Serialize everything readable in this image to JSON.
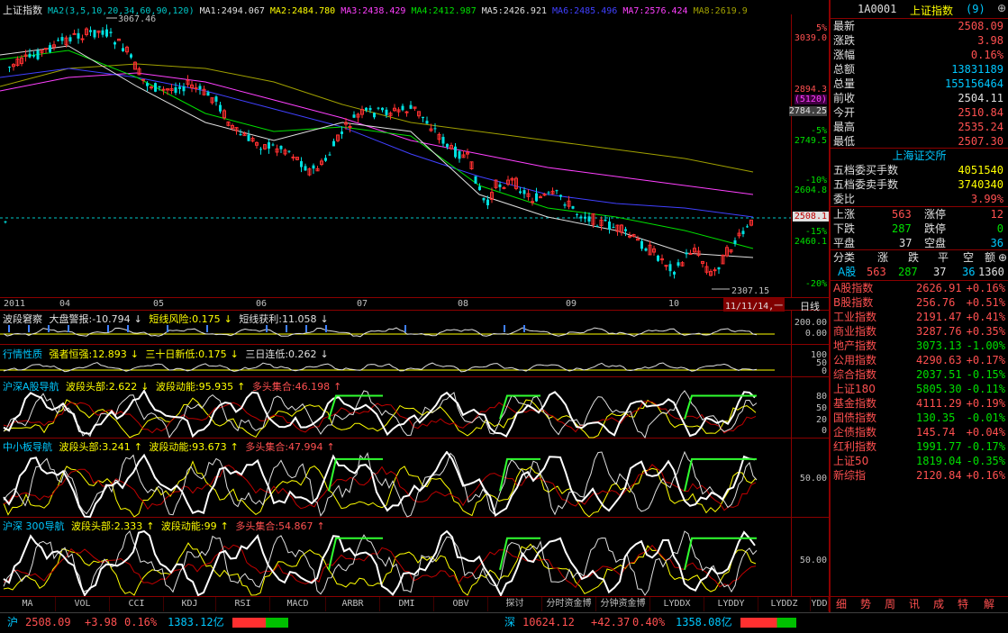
{
  "main_header": {
    "title": "上证指数",
    "ma2": "MA2(3,5,10,20,34,60,90,120)",
    "ma1": "MA1:2494.067",
    "ma2v": "MA2:2484.780",
    "ma3": "MA3:2438.429",
    "ma4": "MA4:2412.987",
    "ma5": "MA5:2426.921",
    "ma6": "MA6:2485.496",
    "ma7": "MA7:2576.424",
    "ma8": "MA8:2619.9"
  },
  "price_axis": {
    "high_mark": "3067.46",
    "low_mark": "2307.15",
    "labels": [
      {
        "pct": "5%",
        "val": "3039.0"
      },
      {
        "pct": "",
        "val": "2894.3"
      },
      {
        "pct": "",
        "val": "(5120)"
      },
      {
        "pct": "",
        "val": "2784.25"
      },
      {
        "pct": "-5%",
        "val": "2749.5"
      },
      {
        "pct": "-10%",
        "val": "2604.8"
      },
      {
        "pct": "",
        "val": "2508.1"
      },
      {
        "pct": "-15%",
        "val": "2460.1"
      },
      {
        "pct": "-20%",
        "val": ""
      }
    ]
  },
  "time_axis": {
    "labels": [
      "2011",
      "04",
      "05",
      "06",
      "07",
      "08",
      "09",
      "10"
    ],
    "cursor_date": "11/11/14,一",
    "period": "日线"
  },
  "panels": [
    {
      "name": "波段窘察",
      "items": [
        {
          "text": "大盘警报:-10.794",
          "arrow": "↓",
          "color": "white"
        },
        {
          "text": "短线风险:0.175",
          "arrow": "↓",
          "color": "yellow"
        },
        {
          "text": "短线获利:11.058",
          "arrow": "↓",
          "color": "white"
        }
      ],
      "axis": [
        "200.00",
        "0.00"
      ]
    },
    {
      "name": "行情性质",
      "items": [
        {
          "text": "强者恒强:12.893",
          "arrow": "↓",
          "color": "yellow"
        },
        {
          "text": "三十日新低:0.175",
          "arrow": "↓",
          "color": "yellow"
        },
        {
          "text": "三日连低:0.262",
          "arrow": "↓",
          "color": "white"
        }
      ],
      "axis": [
        "100",
        "50",
        "0"
      ]
    },
    {
      "name": "沪深A股导航",
      "items": [
        {
          "text": "波段头部:2.622",
          "arrow": "↓",
          "color": "yellow"
        },
        {
          "text": "波段动能:95.935",
          "arrow": "↑",
          "color": "yellow"
        },
        {
          "text": "多头集合:46.198",
          "arrow": "↑",
          "color": "red"
        }
      ],
      "axis": [
        "80",
        "50",
        "20",
        "0"
      ]
    },
    {
      "name": "中小板导航",
      "items": [
        {
          "text": "波段头部:3.241",
          "arrow": "↑",
          "color": "yellow"
        },
        {
          "text": "波段动能:93.673",
          "arrow": "↑",
          "color": "yellow"
        },
        {
          "text": "多头集合:47.994",
          "arrow": "↑",
          "color": "red"
        }
      ],
      "axis": [
        "50.00"
      ]
    },
    {
      "name": "沪深 300导航",
      "items": [
        {
          "text": "波段头部:2.333",
          "arrow": "↑",
          "color": "yellow"
        },
        {
          "text": "波段动能:99",
          "arrow": "↑",
          "color": "yellow"
        },
        {
          "text": "多头集合:54.867",
          "arrow": "↑",
          "color": "red"
        }
      ],
      "axis": [
        "50.00"
      ]
    }
  ],
  "bottom_tabs": [
    "MA",
    "VOL",
    "CCI",
    "KDJ",
    "RSI",
    "MACD",
    "ARBR",
    "DMI",
    "OBV",
    "探讨",
    "分时资金博",
    "分钟资金博",
    "LYDDX",
    "LYDDY",
    "LYDDZ",
    "YDD"
  ],
  "right_panel": {
    "code": "1A0001",
    "name": "上证指数",
    "count": "(9)",
    "quote": [
      {
        "label": "最新",
        "value": "2508.09",
        "color": "red"
      },
      {
        "label": "涨跌",
        "value": "3.98",
        "color": "red"
      },
      {
        "label": "涨幅",
        "value": "0.16%",
        "color": "red"
      },
      {
        "label": "总额",
        "value": "13831189",
        "color": "cyan"
      },
      {
        "label": "总量",
        "value": "155156464",
        "color": "cyan"
      },
      {
        "label": "前收",
        "value": "2504.11",
        "color": "white"
      },
      {
        "label": "今开",
        "value": "2510.84",
        "color": "red"
      },
      {
        "label": "最高",
        "value": "2535.24",
        "color": "red"
      },
      {
        "label": "最低",
        "value": "2507.30",
        "color": "red"
      }
    ],
    "exchange": "上海证交所",
    "orders": [
      {
        "label": "五档委买手数",
        "value": "4051540",
        "color": "yellow"
      },
      {
        "label": "五档委卖手数",
        "value": "3740340",
        "color": "yellow"
      },
      {
        "label": "委比",
        "value": "3.99%",
        "color": "red"
      }
    ],
    "breadth": {
      "up_label": "上涨",
      "up": "563",
      "limit_up_label": "涨停",
      "limit_up": "12",
      "down_label": "下跌",
      "down": "287",
      "limit_down_label": "跌停",
      "limit_down": "0",
      "flat_label": "平盘",
      "flat": "37",
      "empty_label": "空盘",
      "empty": "36"
    },
    "class_header": [
      "分类",
      "涨",
      "跌",
      "平",
      "空",
      "额"
    ],
    "class_row": {
      "name": "A股",
      "up": "563",
      "down": "287",
      "flat": "37",
      "empty": "36",
      "amount": "1360"
    },
    "indices": [
      {
        "name": "A股指数",
        "price": "2626.91",
        "chg": "+0.16%",
        "dir": "up"
      },
      {
        "name": "B股指数",
        "price": "256.76",
        "chg": "+0.51%",
        "dir": "up"
      },
      {
        "name": "工业指数",
        "price": "2191.47",
        "chg": "+0.41%",
        "dir": "up"
      },
      {
        "name": "商业指数",
        "price": "3287.76",
        "chg": "+0.35%",
        "dir": "up"
      },
      {
        "name": "地产指数",
        "price": "3073.13",
        "chg": "-1.00%",
        "dir": "down"
      },
      {
        "name": "公用指数",
        "price": "4290.63",
        "chg": "+0.17%",
        "dir": "up"
      },
      {
        "name": "综合指数",
        "price": "2037.51",
        "chg": "-0.15%",
        "dir": "down"
      },
      {
        "name": "上证180",
        "price": "5805.30",
        "chg": "-0.11%",
        "dir": "down"
      },
      {
        "name": "基金指数",
        "price": "4111.29",
        "chg": "+0.19%",
        "dir": "up"
      },
      {
        "name": "国债指数",
        "price": "130.35",
        "chg": "-0.01%",
        "dir": "down"
      },
      {
        "name": "企债指数",
        "price": "145.74",
        "chg": "+0.04%",
        "dir": "up"
      },
      {
        "name": "红利指数",
        "price": "1991.77",
        "chg": "-0.17%",
        "dir": "down"
      },
      {
        "name": "上证50",
        "price": "1819.04",
        "chg": "-0.35%",
        "dir": "down"
      },
      {
        "name": "新综指",
        "price": "2120.84",
        "chg": "+0.16%",
        "dir": "up"
      }
    ],
    "bottom_tabs": [
      "细",
      "势",
      "周",
      "讯",
      "成",
      "特",
      "解"
    ]
  },
  "status_bar": {
    "sh_label": "沪",
    "sh_price": "2508.09",
    "sh_chg": "+3.98",
    "sh_pct": "0.16%",
    "sh_amount": "1383.12亿",
    "sz_label": "深",
    "sz_price": "10624.12",
    "sz_chg": "+42.37",
    "sz_pct": "0.40%",
    "sz_amount": "1358.08亿"
  },
  "colors": {
    "up": "#ff5050",
    "down": "#00e000",
    "grid": "#8b0000",
    "bg": "#000000"
  }
}
